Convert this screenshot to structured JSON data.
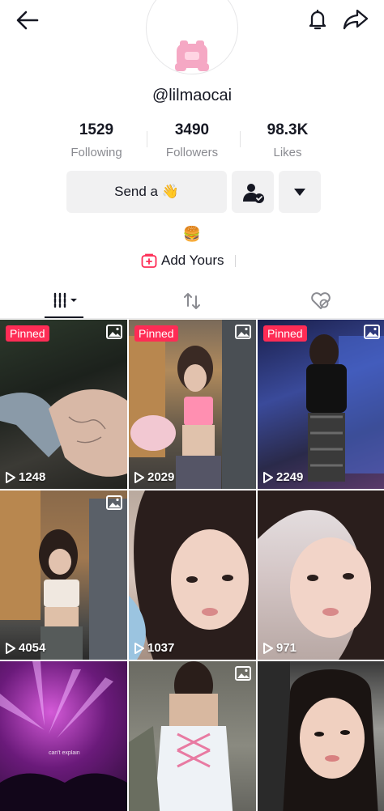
{
  "header": {
    "title": "lilmaocai",
    "back_icon": "arrow-left-icon",
    "bell_icon": "bell-icon",
    "share_icon": "share-arrow-icon"
  },
  "profile": {
    "handle": "@lilmaocai",
    "stats": [
      {
        "value": "1529",
        "label": "Following"
      },
      {
        "value": "3490",
        "label": "Followers"
      },
      {
        "value": "98.3K",
        "label": "Likes"
      }
    ],
    "send_button": "Send a 👋",
    "bio_emoji": "🍔",
    "add_yours": "Add Yours"
  },
  "tabs": [
    {
      "name": "videos",
      "icon": "grid-columns-icon",
      "active": true
    },
    {
      "name": "reposts",
      "icon": "repost-icon",
      "active": false
    },
    {
      "name": "liked",
      "icon": "hidden-heart-icon",
      "active": false
    }
  ],
  "colors": {
    "accent": "#fe2c55",
    "text": "#161823",
    "muted": "#8a8b91",
    "button_bg": "#f1f1f2"
  },
  "posts": [
    {
      "pinned": "Pinned",
      "photo": true,
      "views": "1248"
    },
    {
      "pinned": "Pinned",
      "photo": true,
      "views": "2029"
    },
    {
      "pinned": "Pinned",
      "photo": true,
      "views": "2249"
    },
    {
      "pinned": "",
      "photo": true,
      "views": "4054"
    },
    {
      "pinned": "",
      "photo": false,
      "views": "1037"
    },
    {
      "pinned": "",
      "photo": false,
      "views": "971"
    },
    {
      "pinned": "",
      "photo": false,
      "views": "",
      "caption": "can't explain"
    },
    {
      "pinned": "",
      "photo": true,
      "views": ""
    },
    {
      "pinned": "",
      "photo": false,
      "views": ""
    }
  ]
}
